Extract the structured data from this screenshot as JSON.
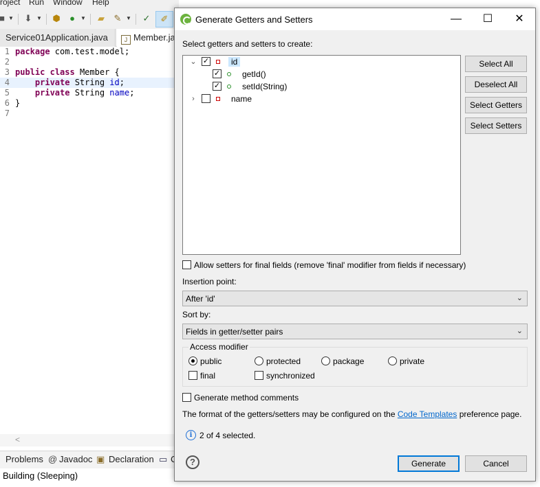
{
  "ide": {
    "menu": [
      "roject",
      "Run",
      "Window",
      "Help"
    ],
    "tabs": [
      "Service01Application.java",
      "Member.jav"
    ],
    "code_lines": [
      {
        "num": "1",
        "parts": [
          {
            "t": "package",
            "k": "kw"
          },
          {
            "t": " com.test.model;",
            "k": ""
          }
        ]
      },
      {
        "num": "2",
        "parts": []
      },
      {
        "num": "3",
        "parts": [
          {
            "t": "public",
            "k": "kw"
          },
          {
            "t": " ",
            "k": ""
          },
          {
            "t": "class",
            "k": "kw"
          },
          {
            "t": " Member {",
            "k": ""
          }
        ]
      },
      {
        "num": "4",
        "parts": [
          {
            "t": "    ",
            "k": ""
          },
          {
            "t": "private",
            "k": "kw"
          },
          {
            "t": " String ",
            "k": ""
          },
          {
            "t": "id",
            "k": "fld"
          },
          {
            "t": ";",
            "k": ""
          }
        ]
      },
      {
        "num": "5",
        "parts": [
          {
            "t": "    ",
            "k": ""
          },
          {
            "t": "private",
            "k": "kw"
          },
          {
            "t": " String ",
            "k": ""
          },
          {
            "t": "name",
            "k": "fld"
          },
          {
            "t": ";",
            "k": ""
          }
        ]
      },
      {
        "num": "6",
        "parts": [
          {
            "t": "}",
            "k": ""
          }
        ]
      },
      {
        "num": "7",
        "parts": []
      }
    ],
    "scroll_left": "<",
    "bottom_tabs": {
      "problems": "Problems",
      "javadoc": "Javadoc",
      "declaration": "Declaration",
      "console": "C"
    },
    "status": "Building (Sleeping)"
  },
  "dialog": {
    "title": "Generate Getters and Setters",
    "select_label": "Select getters and setters to create:",
    "tree": {
      "id": {
        "label": "id",
        "checked": true,
        "expanded": true
      },
      "getter": {
        "label": "getId()",
        "checked": true
      },
      "setter": {
        "label": "setId(String)",
        "checked": true
      },
      "name": {
        "label": "name",
        "checked": false,
        "expanded": false
      }
    },
    "buttons": {
      "select_all": "Select All",
      "deselect_all": "Deselect All",
      "select_getters": "Select Getters",
      "select_setters": "Select Setters",
      "generate": "Generate",
      "cancel": "Cancel"
    },
    "allow_setters_final": "Allow setters for final fields (remove 'final' modifier from fields if necessary)",
    "insertion_point_label": "Insertion point:",
    "insertion_point_value": "After 'id'",
    "sort_by_label": "Sort by:",
    "sort_by_value": "Fields in getter/setter pairs",
    "access_modifier": {
      "title": "Access modifier",
      "options": [
        "public",
        "protected",
        "package",
        "private"
      ],
      "selected": "public",
      "final_label": "final",
      "synchronized_label": "synchronized"
    },
    "generate_comments": "Generate method comments",
    "info_prefix": "The format of the getters/setters may be configured on the",
    "info_link": "Code Templates",
    "info_suffix": "preference page.",
    "selected_count": "2 of 4 selected.",
    "accent_color": "#0078d7",
    "spring_icon_color": "#6db33f"
  }
}
